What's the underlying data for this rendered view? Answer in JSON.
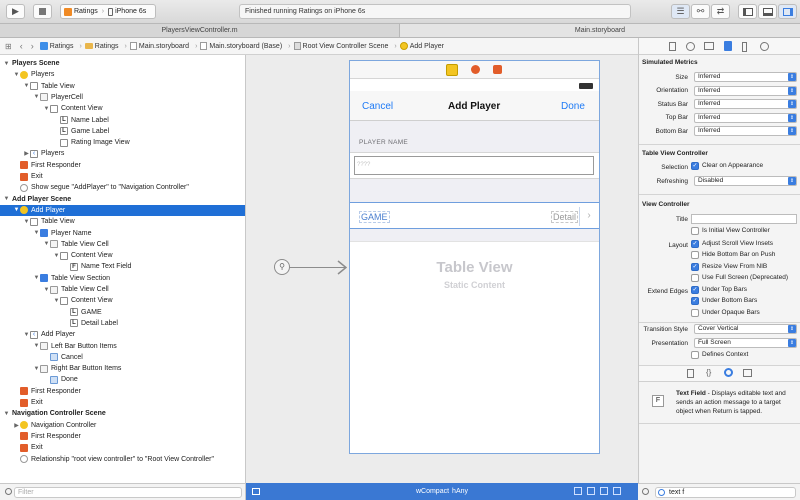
{
  "toolbar": {
    "scheme": "Ratings",
    "device": "iPhone 6s",
    "status": "Finished running Ratings on iPhone 6s"
  },
  "tabs": [
    "PlayersViewController.m",
    "Main.storyboard"
  ],
  "jumpbar": [
    "Ratings",
    "Ratings",
    "Main.storyboard",
    "Main.storyboard (Base)",
    "Root View Controller Scene",
    "Add Player"
  ],
  "outline": {
    "rows": [
      {
        "t": "Players Scene",
        "d": 0,
        "i": "none",
        "disc": "▼",
        "head": true
      },
      {
        "t": "Players",
        "d": 1,
        "i": "y",
        "disc": "▼"
      },
      {
        "t": "Table View",
        "d": 2,
        "i": "tv",
        "disc": "▼"
      },
      {
        "t": "PlayerCell",
        "d": 3,
        "i": "cell",
        "disc": "▼"
      },
      {
        "t": "Content View",
        "d": 4,
        "i": "cv",
        "disc": "▼"
      },
      {
        "t": "Name Label",
        "d": 5,
        "i": "lbl",
        "disc": ""
      },
      {
        "t": "Game Label",
        "d": 5,
        "i": "lbl",
        "disc": ""
      },
      {
        "t": "Rating Image View",
        "d": 5,
        "i": "cv",
        "disc": ""
      },
      {
        "t": "Players",
        "d": 2,
        "i": "back",
        "disc": "▶"
      },
      {
        "t": "First Responder",
        "d": 1,
        "i": "fr",
        "disc": ""
      },
      {
        "t": "Exit",
        "d": 1,
        "i": "exit",
        "disc": ""
      },
      {
        "t": "Show segue \"AddPlayer\" to \"Navigation Controller\"",
        "d": 1,
        "i": "circ",
        "disc": ""
      },
      {
        "t": "Add Player Scene",
        "d": 0,
        "i": "none",
        "disc": "▼",
        "head": true
      },
      {
        "t": "Add Player",
        "d": 1,
        "i": "y",
        "disc": "▼",
        "sel": true
      },
      {
        "t": "Table View",
        "d": 2,
        "i": "tv",
        "disc": "▼"
      },
      {
        "t": "Player Name",
        "d": 3,
        "i": "cube",
        "disc": "▼"
      },
      {
        "t": "Table View Cell",
        "d": 4,
        "i": "cell",
        "disc": "▼"
      },
      {
        "t": "Content View",
        "d": 5,
        "i": "cv",
        "disc": "▼"
      },
      {
        "t": "Name Text Field",
        "d": 6,
        "i": "lbl",
        "disc": ""
      },
      {
        "t": "Table View Section",
        "d": 3,
        "i": "cube",
        "disc": "▼"
      },
      {
        "t": "Table View Cell",
        "d": 4,
        "i": "cell",
        "disc": "▼"
      },
      {
        "t": "Content View",
        "d": 5,
        "i": "cv",
        "disc": "▼"
      },
      {
        "t": "GAME",
        "d": 6,
        "i": "lbl",
        "disc": ""
      },
      {
        "t": "Detail Label",
        "d": 6,
        "i": "lbl",
        "disc": ""
      },
      {
        "t": "Add Player",
        "d": 2,
        "i": "back",
        "disc": "▼"
      },
      {
        "t": "Left Bar Button Items",
        "d": 3,
        "i": "bbi",
        "disc": "▼"
      },
      {
        "t": "Cancel",
        "d": 4,
        "i": "bi",
        "disc": ""
      },
      {
        "t": "Right Bar Button Items",
        "d": 3,
        "i": "bbi",
        "disc": "▼"
      },
      {
        "t": "Done",
        "d": 4,
        "i": "bi",
        "disc": ""
      },
      {
        "t": "First Responder",
        "d": 1,
        "i": "fr",
        "disc": ""
      },
      {
        "t": "Exit",
        "d": 1,
        "i": "exit",
        "disc": ""
      },
      {
        "t": "Navigation Controller Scene",
        "d": 0,
        "i": "none",
        "disc": "▼",
        "head": true
      },
      {
        "t": "Navigation Controller",
        "d": 1,
        "i": "nav",
        "disc": "▶"
      },
      {
        "t": "First Responder",
        "d": 1,
        "i": "fr",
        "disc": ""
      },
      {
        "t": "Exit",
        "d": 1,
        "i": "exit",
        "disc": ""
      },
      {
        "t": "Relationship \"root view controller\" to \"Root View Controller\"",
        "d": 1,
        "i": "circ",
        "disc": ""
      }
    ]
  },
  "filter": {
    "placeholder": "Filter"
  },
  "phone": {
    "cancel": "Cancel",
    "title": "Add Player",
    "done": "Done",
    "section_header": "PLAYER NAME",
    "field_placeholder": "????",
    "game": "GAME",
    "detail": "Detail",
    "table_view": "Table View",
    "static_content": "Static Content"
  },
  "size_class": {
    "w": "wCompact",
    "h": "hAny"
  },
  "inspector": {
    "simulated_metrics": "Simulated Metrics",
    "metrics": [
      {
        "label": "Size",
        "value": "Inferred"
      },
      {
        "label": "Orientation",
        "value": "Inferred"
      },
      {
        "label": "Status Bar",
        "value": "Inferred"
      },
      {
        "label": "Top Bar",
        "value": "Inferred"
      },
      {
        "label": "Bottom Bar",
        "value": "Inferred"
      }
    ],
    "tvc_title": "Table View Controller",
    "selection_label": "Selection",
    "selection_value": "Clear on Appearance",
    "refreshing_label": "Refreshing",
    "refreshing_value": "Disabled",
    "vc_title": "View Controller",
    "title_label": "Title",
    "initial_vc": "Is Initial View Controller",
    "layout_label": "Layout",
    "layout_opts": [
      {
        "t": "Adjust Scroll View Insets",
        "on": true
      },
      {
        "t": "Hide Bottom Bar on Push",
        "on": false
      },
      {
        "t": "Resize View From NIB",
        "on": true
      },
      {
        "t": "Use Full Screen (Deprecated)",
        "on": false
      }
    ],
    "edges_label": "Extend Edges",
    "edges_opts": [
      {
        "t": "Under Top Bars",
        "on": true
      },
      {
        "t": "Under Bottom Bars",
        "on": true
      },
      {
        "t": "Under Opaque Bars",
        "on": false
      }
    ],
    "transition_label": "Transition Style",
    "transition_value": "Cover Vertical",
    "presentation_label": "Presentation",
    "presentation_value": "Full Screen",
    "defines_context": "Defines Context"
  },
  "library": {
    "item_title": "Text Field",
    "item_desc": " - Displays editable text and sends an action message to a target object when Return is tapped.",
    "search_value": "text f"
  }
}
